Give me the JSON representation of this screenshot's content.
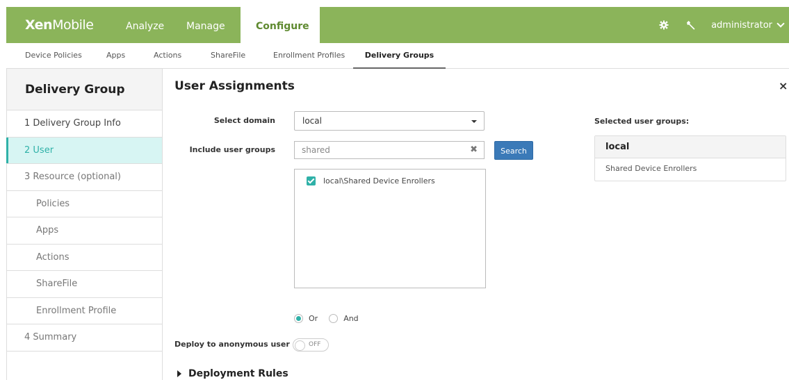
{
  "app": {
    "logo_bold": "Xen",
    "logo_light": "Mobile",
    "user": "administrator",
    "colors": {
      "brand_green": "#8bb45a",
      "accent_teal": "#2fb1a8",
      "button_blue": "#3b7ab8"
    },
    "icons": [
      "gear-icon",
      "wrench-icon",
      "chevron-down-icon"
    ]
  },
  "top_nav": [
    "Analyze",
    "Manage",
    "Configure"
  ],
  "sub_nav": [
    "Device Policies",
    "Apps",
    "Actions",
    "ShareFile",
    "Enrollment Profiles",
    "Delivery Groups"
  ],
  "sidebar": {
    "title": "Delivery Group",
    "items": [
      "1 Delivery Group Info",
      "2 User",
      "3 Resource (optional)",
      "Policies",
      "Apps",
      "Actions",
      "ShareFile",
      "Enrollment Profile",
      "4 Summary"
    ]
  },
  "main": {
    "title": "User Assignments",
    "close": "×",
    "select_domain_label": "Select domain",
    "domain_value": "local",
    "include_groups_label": "Include user groups",
    "search_value": "shared",
    "clear": "✖",
    "search_button": "Search",
    "results": [
      "local\\Shared Device Enrollers"
    ],
    "or_label": "Or",
    "and_label": "And",
    "deploy_anon_label": "Deploy to anonymous user",
    "toggle_value": "OFF",
    "deployment_rules": "Deployment Rules"
  },
  "selected_panel": {
    "label": "Selected user groups:",
    "group_name": "local",
    "group_item": "Shared Device Enrollers"
  }
}
